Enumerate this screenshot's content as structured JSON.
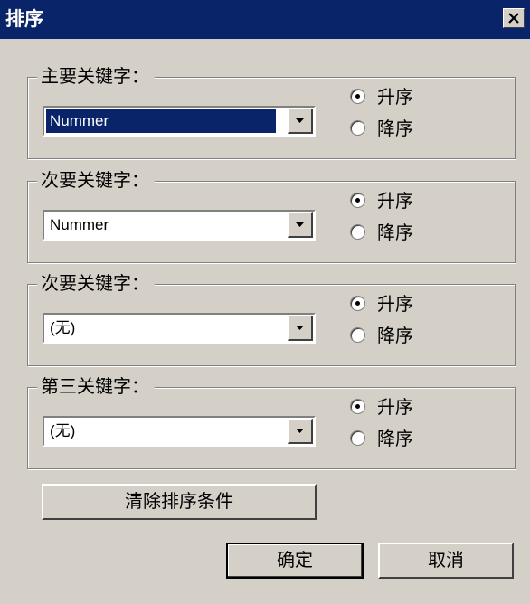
{
  "dialog": {
    "title": "排序",
    "close_icon": "close-icon"
  },
  "groups": [
    {
      "legend": "主要关键字：",
      "value": "Nummer",
      "selected": true,
      "options": [
        "升序",
        "降序"
      ],
      "checked": 0
    },
    {
      "legend": "次要关键字：",
      "value": "Nummer",
      "selected": false,
      "options": [
        "升序",
        "降序"
      ],
      "checked": 0
    },
    {
      "legend": "次要关键字：",
      "value": "(无)",
      "selected": false,
      "options": [
        "升序",
        "降序"
      ],
      "checked": 0
    },
    {
      "legend": "第三关键字：",
      "value": "(无)",
      "selected": false,
      "options": [
        "升序",
        "降序"
      ],
      "checked": 0
    }
  ],
  "buttons": {
    "clear": "清除排序条件",
    "ok": "确定",
    "cancel": "取消"
  },
  "colors": {
    "titlebar": "#0a246a",
    "face": "#d4d0c8",
    "selection": "#0a246a"
  }
}
